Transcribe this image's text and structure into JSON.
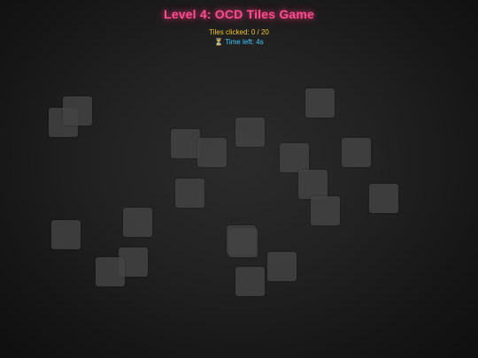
{
  "game": {
    "title": "Level 4: OCD Tiles Game",
    "counter_text": "Tiles clicked: 0 / 20",
    "timer_icon": "hourglass-icon",
    "timer_text": "Time left: 4s",
    "tiles_total": 20,
    "tiles_clicked": 0,
    "colors": {
      "title": "#ff4d8d",
      "counter": "#f1c232",
      "timer": "#3fc8ff",
      "tile": "#444444"
    }
  }
}
